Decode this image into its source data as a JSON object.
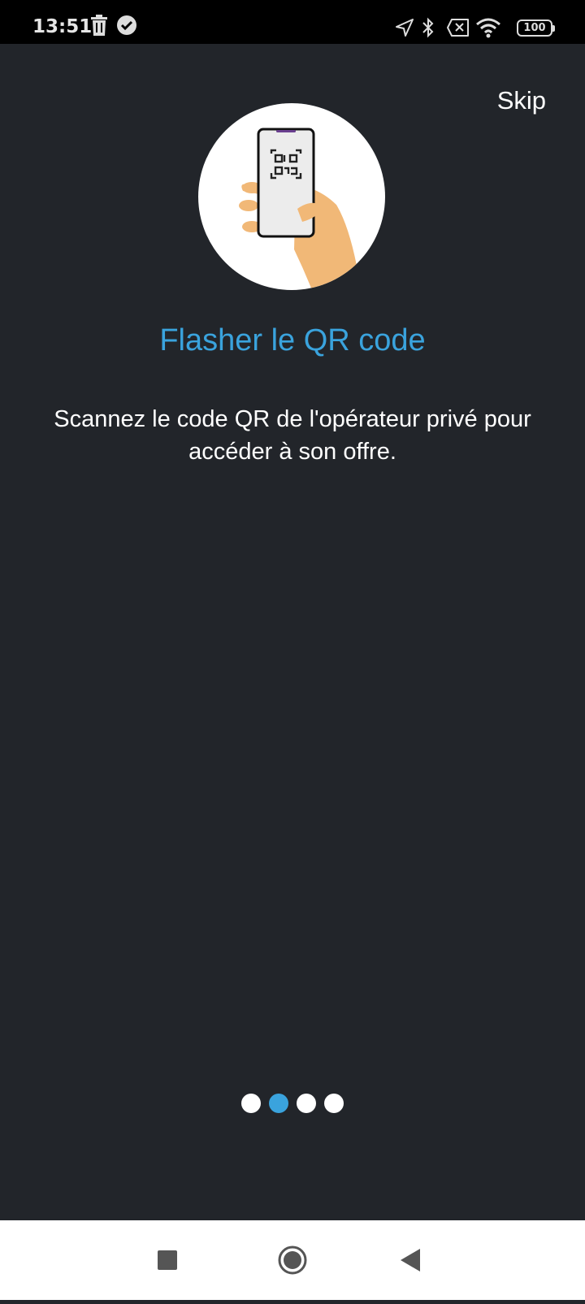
{
  "status_bar": {
    "time": "13:51",
    "battery": "100",
    "icons": [
      "trash-icon",
      "check-circle-icon",
      "location-arrow-icon",
      "bluetooth-icon",
      "sim-error-icon",
      "wifi-icon",
      "battery-icon"
    ]
  },
  "onboarding": {
    "skip_label": "Skip",
    "title": "Flasher le QR code",
    "description": "Scannez le code QR de l'opérateur privé pour accéder à son offre.",
    "illustration": "hand-holding-phone-qr-icon",
    "page_indicator": {
      "total": 4,
      "current": 2
    }
  },
  "colors": {
    "background": "#22252a",
    "accent": "#3aa3dd",
    "status_bar": "#000000",
    "navbar": "#ffffff"
  },
  "nav_bar": {
    "buttons": [
      "recent-apps-icon",
      "home-icon",
      "back-icon"
    ]
  }
}
